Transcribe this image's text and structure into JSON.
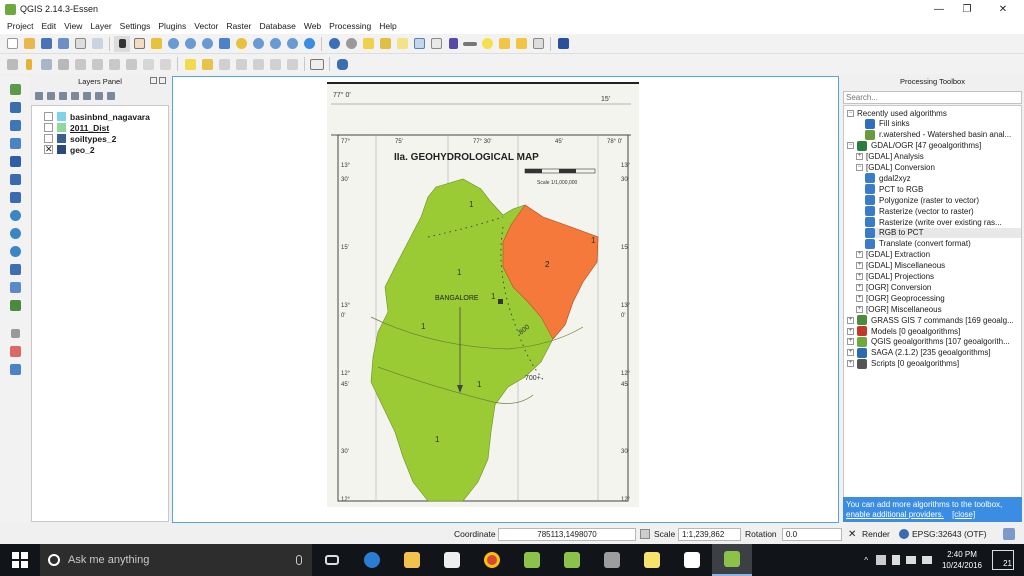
{
  "window": {
    "title": "QGIS 2.14.3-Essen",
    "minimize": "—",
    "restore": "❐",
    "close": "✕"
  },
  "menu": [
    "Project",
    "Edit",
    "View",
    "Layer",
    "Settings",
    "Plugins",
    "Vector",
    "Raster",
    "Database",
    "Web",
    "Processing",
    "Help"
  ],
  "layers_panel": {
    "title": "Layers Panel",
    "layers": [
      {
        "name": "basinbnd_nagavara",
        "checked": false,
        "swatch": "#7fd3e8"
      },
      {
        "name": "2011_Dist",
        "checked": false,
        "swatch": "#8fd9a0",
        "underline": true
      },
      {
        "name": "soiltypes_2",
        "checked": false,
        "swatch": "#3d5f8f"
      },
      {
        "name": "geo_2",
        "checked": true,
        "swatch": "#2c4a77",
        "mark": "✕"
      }
    ]
  },
  "map": {
    "title": "IIa. GEOHYDROLOGICAL MAP",
    "scale_label": "Scale 1/1,000,000",
    "city": "BANGALORE",
    "zone_labels": [
      "1",
      "1",
      "1",
      "2",
      "1",
      "1",
      "1",
      "1"
    ],
    "contour_labels": [
      "800",
      "700+"
    ],
    "top_lon_labels": [
      "77° 0'",
      "15'"
    ],
    "frame_lon_labels": [
      "77°",
      "75'",
      "77° 30'",
      "45'",
      "78° 0'"
    ],
    "left_lat_labels": [
      "13°",
      "30'",
      "15'",
      "13°",
      "0'",
      "12°",
      "45'",
      "30'",
      "12°"
    ],
    "right_lat_labels": [
      "13°",
      "30'",
      "15'",
      "13°",
      "0'",
      "12°",
      "45'",
      "30'",
      "12°"
    ],
    "colors": {
      "zone1": "#9acb34",
      "zone2": "#f4793b",
      "paper": "#f4f4ee"
    }
  },
  "toolbox": {
    "title": "Processing Toolbox",
    "search_placeholder": "Search...",
    "rows": [
      {
        "text": "Recently used algorithms",
        "level": 0,
        "exp": "−"
      },
      {
        "text": "Fill sinks",
        "level": 2,
        "icon": "#2f6fbf"
      },
      {
        "text": "r.watershed - Watershed basin anal...",
        "level": 2,
        "icon": "#6a9a3a"
      },
      {
        "text": "GDAL/OGR [47 geoalgorithms]",
        "level": 0,
        "exp": "−",
        "icon": "#2d7d3a"
      },
      {
        "text": "[GDAL] Analysis",
        "level": 1,
        "exp": "+"
      },
      {
        "text": "[GDAL] Conversion",
        "level": 1,
        "exp": "−"
      },
      {
        "text": "gdal2xyz",
        "level": 2,
        "icon": "#3a7cc9"
      },
      {
        "text": "PCT to RGB",
        "level": 2,
        "icon": "#3a7cc9"
      },
      {
        "text": "Polygonize (raster to vector)",
        "level": 2,
        "icon": "#3a7cc9"
      },
      {
        "text": "Rasterize (vector to raster)",
        "level": 2,
        "icon": "#3a7cc9"
      },
      {
        "text": "Rasterize (write over existing ras...",
        "level": 2,
        "icon": "#3a7cc9"
      },
      {
        "text": "RGB to PCT",
        "level": 2,
        "icon": "#3a7cc9",
        "hl": true
      },
      {
        "text": "Translate (convert format)",
        "level": 2,
        "icon": "#3a7cc9"
      },
      {
        "text": "[GDAL] Extraction",
        "level": 1,
        "exp": "+"
      },
      {
        "text": "[GDAL] Miscellaneous",
        "level": 1,
        "exp": "+"
      },
      {
        "text": "[GDAL] Projections",
        "level": 1,
        "exp": "+"
      },
      {
        "text": "[OGR] Conversion",
        "level": 1,
        "exp": "+"
      },
      {
        "text": "[OGR] Geoprocessing",
        "level": 1,
        "exp": "+"
      },
      {
        "text": "[OGR] Miscellaneous",
        "level": 1,
        "exp": "+"
      },
      {
        "text": "GRASS GIS 7 commands [169 geoalg...",
        "level": 0,
        "exp": "+",
        "icon": "#4e8a3b"
      },
      {
        "text": "Models [0 geoalgorithms]",
        "level": 0,
        "exp": "+",
        "icon": "#c0392b"
      },
      {
        "text": "QGIS geoalgorithms [107 geoalgorith...",
        "level": 0,
        "exp": "+",
        "icon": "#6fa83e"
      },
      {
        "text": "SAGA (2.1.2) [235 geoalgorithms]",
        "level": 0,
        "exp": "+",
        "icon": "#2b6cb0"
      },
      {
        "text": "Scripts [0 geoalgorithms]",
        "level": 0,
        "exp": "+",
        "icon": "#555555"
      }
    ],
    "notice_text": "You can add more algorithms to the toolbox,",
    "notice_link": "enable additional providers.",
    "notice_close": "[close]"
  },
  "statusbar": {
    "coordinate_label": "Coordinate",
    "coordinate_value": "785113,1498070",
    "scale_label": "Scale",
    "scale_value": "1:1,239,862",
    "rotation_label": "Rotation",
    "rotation_value": "0.0",
    "render_label": "Render",
    "crs": "EPSG:32643 (OTF)"
  },
  "taskbar": {
    "search_placeholder": "Ask me anything",
    "time": "2:40 PM",
    "date": "10/24/2016",
    "notification_count": "21",
    "apps": [
      {
        "name": "task-view",
        "color": "#ffffff"
      },
      {
        "name": "edge",
        "color": "#2b7cd3"
      },
      {
        "name": "file-explorer",
        "color": "#f2c14e"
      },
      {
        "name": "store",
        "color": "#ffffff"
      },
      {
        "name": "chrome",
        "color": "#db4437"
      },
      {
        "name": "qgis-1",
        "color": "#8bc34a"
      },
      {
        "name": "qgis-2",
        "color": "#8bc34a"
      },
      {
        "name": "app-window",
        "color": "#9e9e9e"
      },
      {
        "name": "sticky-notes",
        "color": "#f7e26b"
      },
      {
        "name": "photos",
        "color": "#ffffff"
      },
      {
        "name": "qgis-active",
        "color": "#8bc34a"
      }
    ]
  }
}
